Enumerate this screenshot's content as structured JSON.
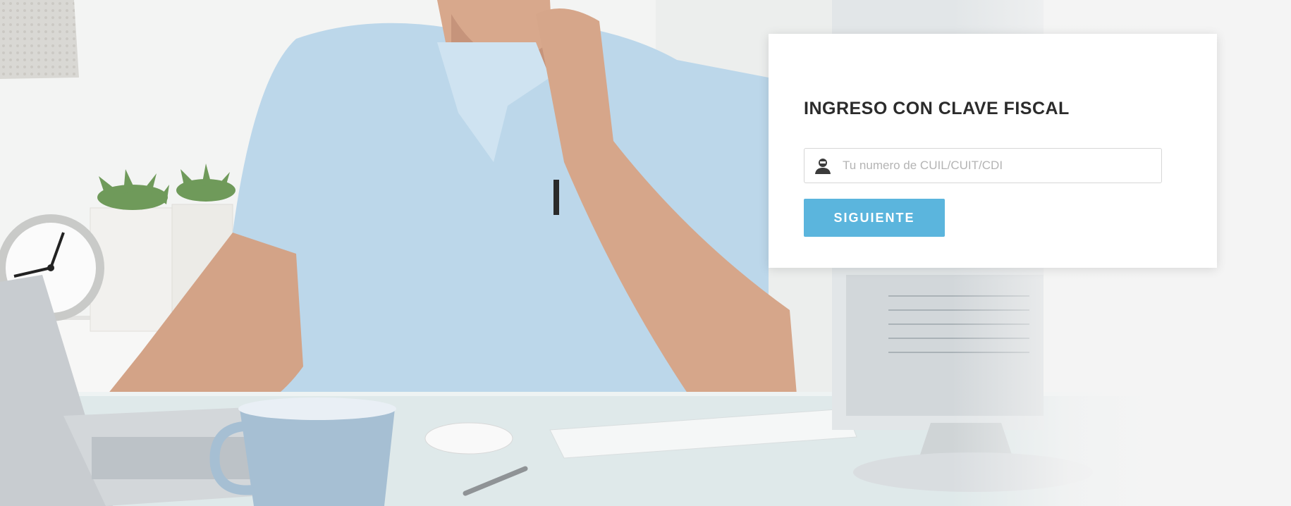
{
  "login": {
    "title": "INGRESO CON CLAVE FISCAL",
    "id_placeholder": "Tu numero de CUIL/CUIT/CDI",
    "id_value": "",
    "next_label": "SIGUIENTE",
    "field_icon": "user-id-icon"
  },
  "colors": {
    "button": "#5bb5dd",
    "title": "#2b2b2b",
    "placeholder": "#b4b4b4",
    "card": "#ffffff"
  }
}
